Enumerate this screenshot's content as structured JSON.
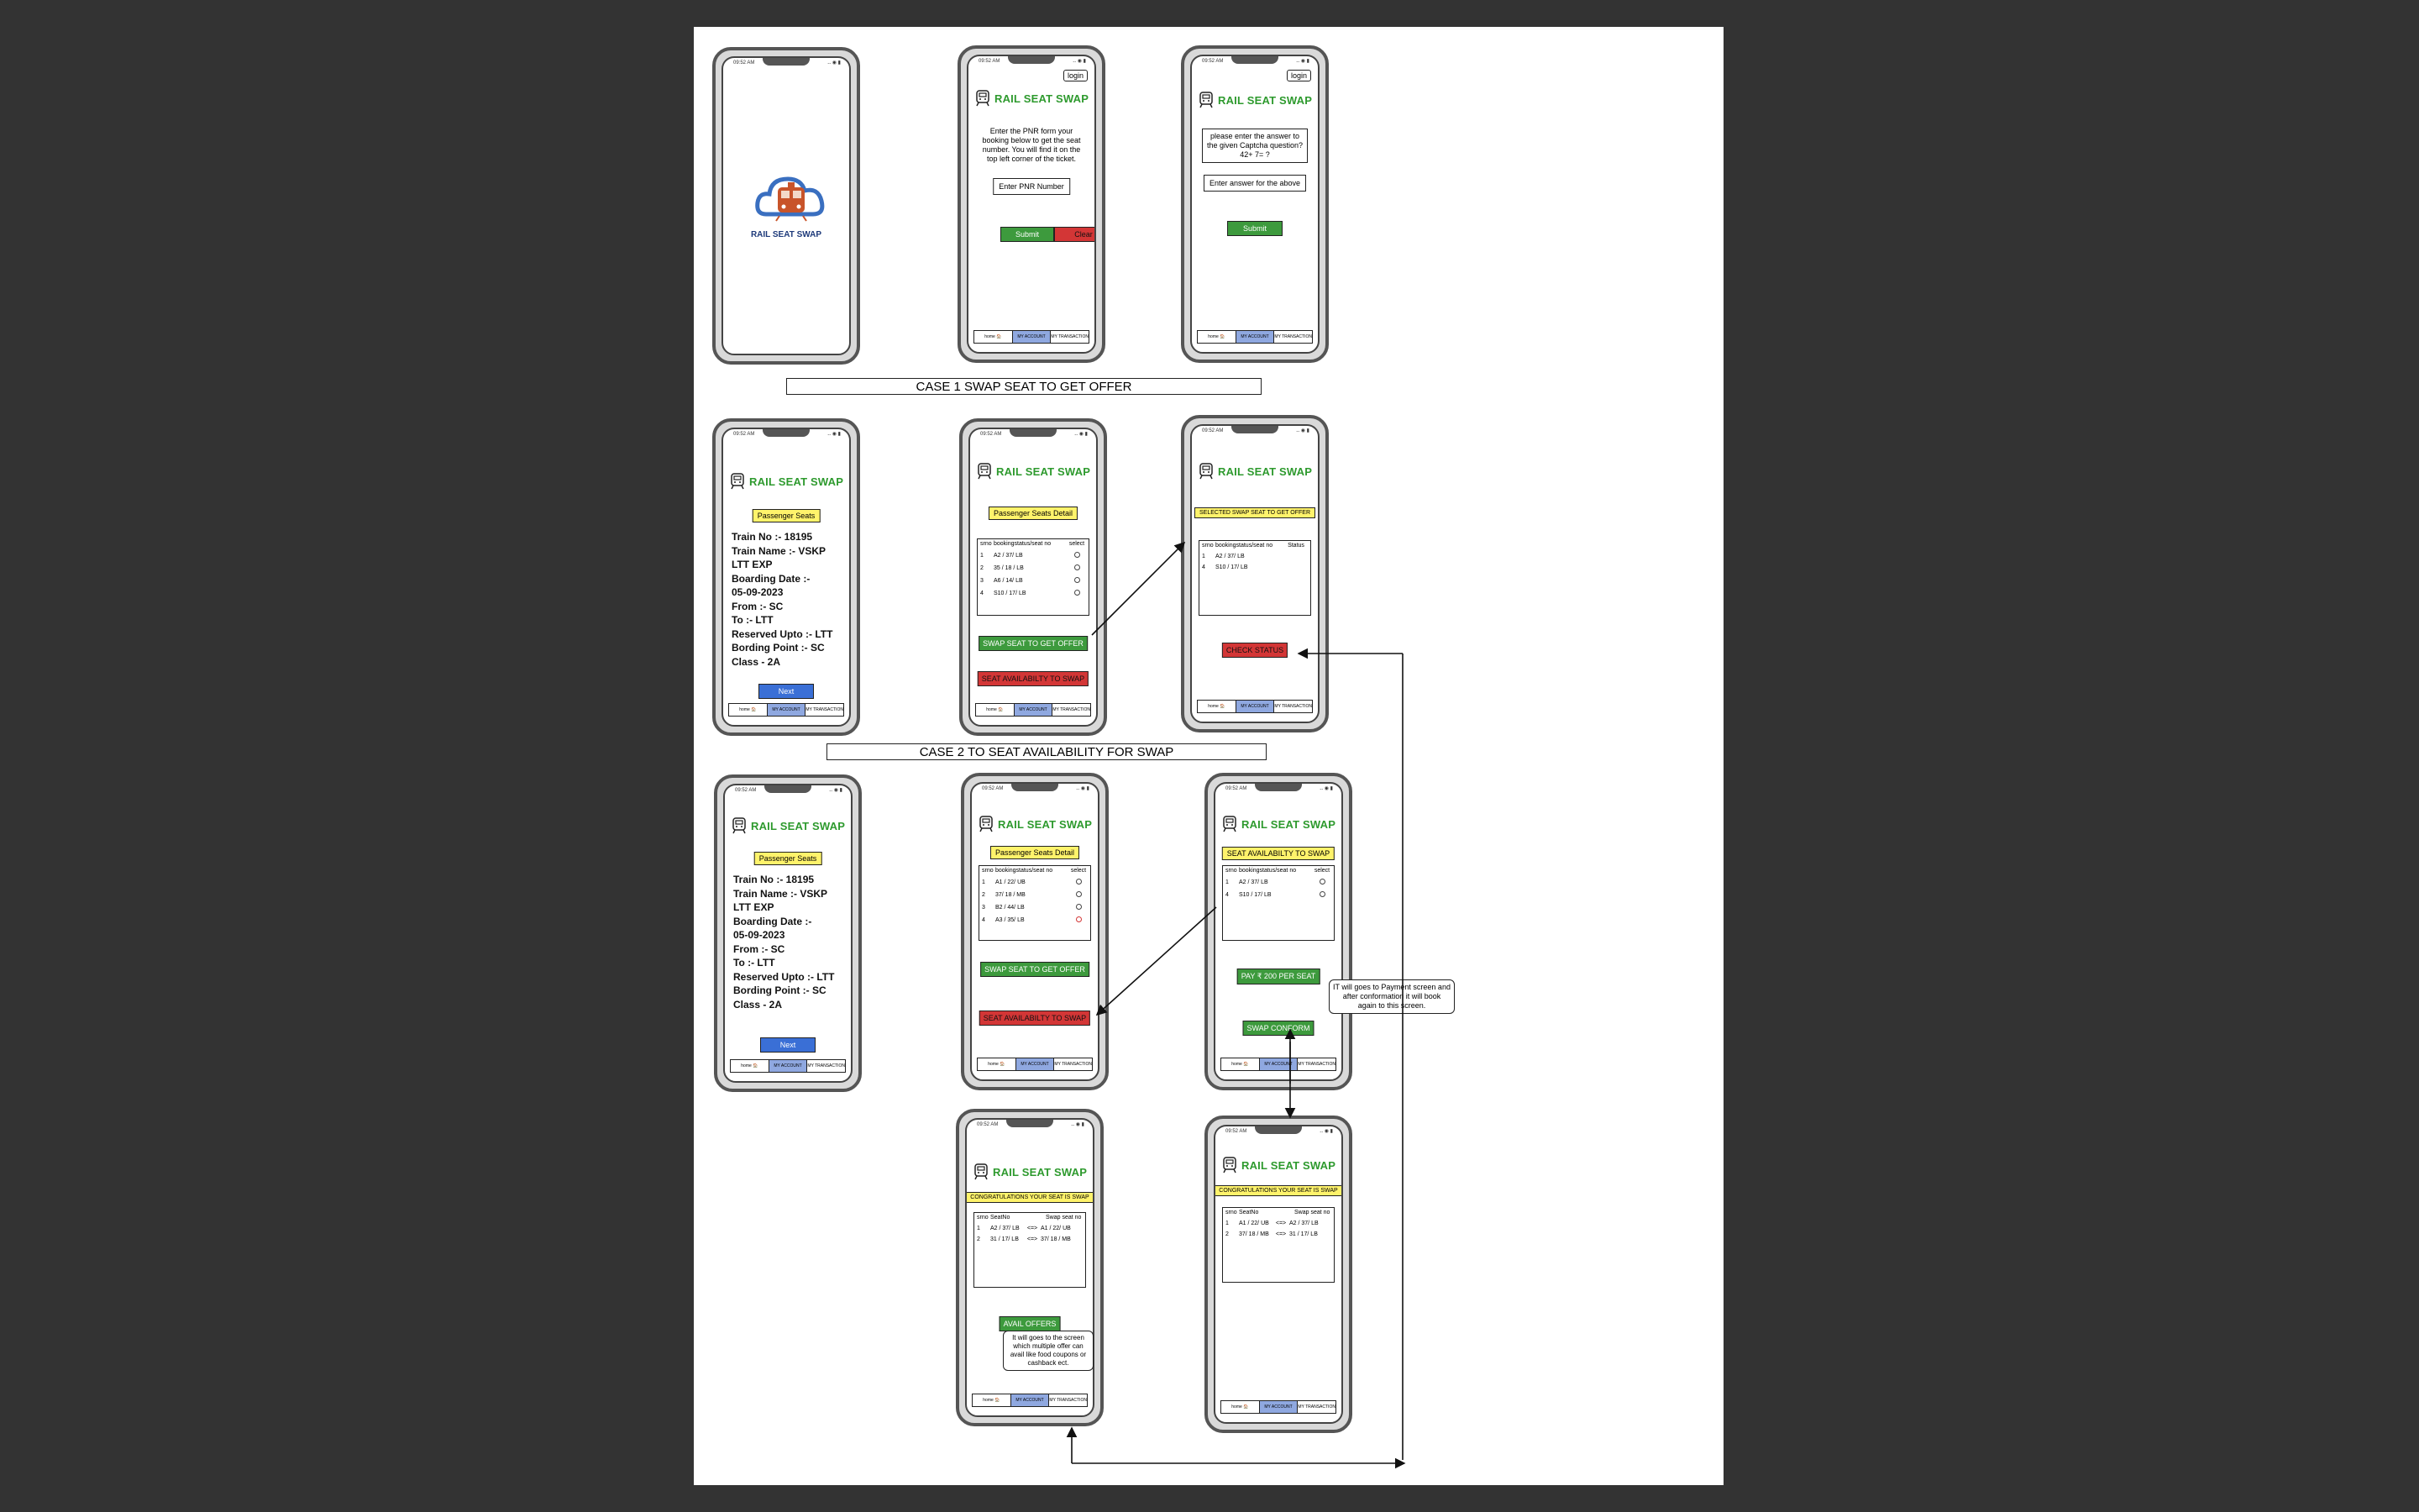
{
  "common": {
    "time": "09:52 AM",
    "status_icons": "‥ ◉ ▮",
    "brand": "RAIL SEAT SWAP",
    "login": "login",
    "tabs": [
      "home 🏠",
      "MY ACCOUNT",
      "MY TRANSACTION"
    ]
  },
  "splash": {
    "logo_text": "RAIL SEAT SWAP"
  },
  "pnr": {
    "instructions": "Enter the PNR form your booking below to get the seat number. You will find it on the top left corner of the ticket.",
    "input_placeholder": "Enter PNR Number",
    "submit": "Submit",
    "clear": "Clear"
  },
  "captcha": {
    "question": "please enter the answer to the given Captcha question? 42+ 7= ?",
    "input_placeholder": "Enter answer for the above",
    "submit": "Submit"
  },
  "case1_label": "CASE 1 SWAP SEAT TO GET OFFER",
  "case2_label": "CASE 2 TO SEAT AVAILABILITY FOR SWAP",
  "passenger_seats": {
    "label": "Passenger Seats",
    "lines": [
      "Train No :- 18195",
      "Train Name :- VSKP",
      "LTT EXP",
      "Boarding Date :-",
      "05-09-2023",
      "From :- SC",
      "To :- LTT",
      "Reserved Upto :- LTT",
      "Bording Point :- SC",
      "Class - 2A"
    ],
    "next": "Next"
  },
  "seat_detail_1": {
    "label": "Passenger Seats Detail",
    "headers": [
      "srno",
      "bookingstatus/seat no",
      "select"
    ],
    "rows": [
      [
        "1",
        "A2 / 37/ LB"
      ],
      [
        "2",
        "35 / 18 / LB"
      ],
      [
        "3",
        "A6 / 14/ LB"
      ],
      [
        "4",
        "S10 / 17/ LB"
      ]
    ],
    "swap_btn": "SWAP SEAT TO GET OFFER",
    "avail_btn": "SEAT AVAILABILTY TO SWAP"
  },
  "selected_swap": {
    "label": "SELECTED SWAP SEAT TO GET OFFER",
    "headers": [
      "srno",
      "bookingstatus/seat no",
      "Status"
    ],
    "rows": [
      [
        "1",
        "A2 / 37/ LB"
      ],
      [
        "4",
        "S10 / 17/ LB"
      ]
    ],
    "check_btn": "CHECK STATUS"
  },
  "seat_detail_2": {
    "label": "Passenger Seats Detail",
    "headers": [
      "srno",
      "bookingstatus/seat no",
      "select"
    ],
    "rows": [
      [
        "1",
        "A1 / 22/ UB"
      ],
      [
        "2",
        "37/ 18 / MB"
      ],
      [
        "3",
        "B2 / 44/ LB"
      ],
      [
        "4",
        "A3 / 35/ LB"
      ]
    ],
    "swap_btn": "SWAP SEAT TO GET OFFER",
    "avail_btn": "SEAT AVAILABILTY TO SWAP"
  },
  "availability": {
    "label": "SEAT AVAILABILTY TO SWAP",
    "headers": [
      "srno",
      "bookingstatus/seat no",
      "select"
    ],
    "rows": [
      [
        "1",
        "A2 / 37/ LB"
      ],
      [
        "4",
        "S10 / 17/ LB"
      ]
    ],
    "pay_btn": "PAY ₹ 200 PER SEAT",
    "confirm_btn": "SWAP CONFORM",
    "note": "IT will goes to Payment screen and after conformation it will book again to this screen."
  },
  "congrats_1": {
    "label": "CONGRATULATIONS YOUR SEAT IS SWAP",
    "headers": [
      "srno",
      "SeatNo",
      "Swap seat no"
    ],
    "rows": [
      [
        "1",
        "A2 / 37/ LB",
        "<=>",
        "A1 / 22/ UB"
      ],
      [
        "2",
        "31 / 17/ LB",
        "<=>",
        "37/ 18 / MB"
      ]
    ],
    "offers_btn": "AVAIL OFFERS",
    "note": "It will goes to the screen which multiple offer can avail like food coupons or cashback ect."
  },
  "congrats_2": {
    "label": "CONGRATULATIONS YOUR SEAT IS SWAP",
    "headers": [
      "srno",
      "SeatNo",
      "Swap seat no"
    ],
    "rows": [
      [
        "1",
        "A1 / 22/ UB",
        "<=>",
        "A2 / 37/ LB"
      ],
      [
        "2",
        "37/ 18 / MB",
        "<=>",
        "31 / 17/ LB"
      ]
    ]
  },
  "colors": {
    "brand_green": "#2e9a2e",
    "label_yellow": "#fff36b",
    "button_green": "#3d9a3d",
    "button_red": "#d33636",
    "button_blue": "#3a6fd6",
    "tab_active": "#8fa8e0"
  }
}
